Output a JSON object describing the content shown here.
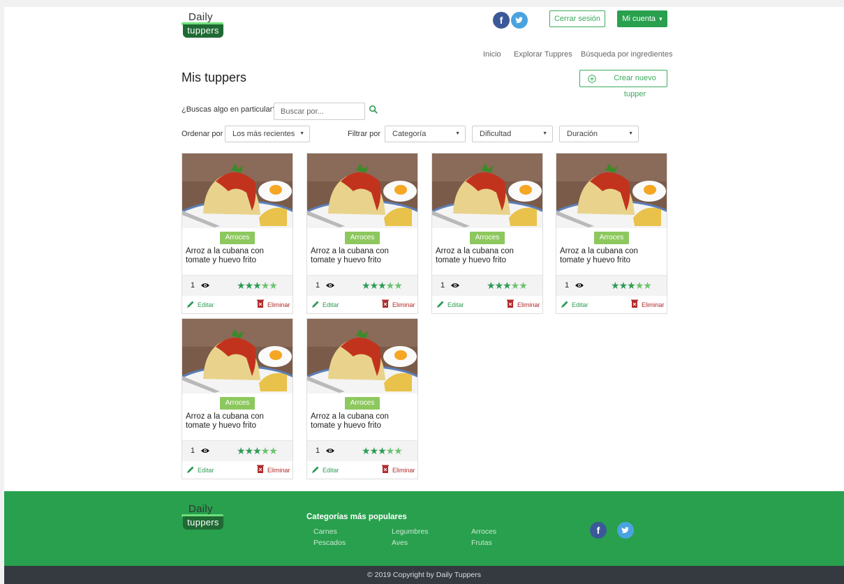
{
  "brand": {
    "line1": "Daily",
    "line2": "tuppers"
  },
  "header": {
    "facebook_glyph": "f",
    "twitter_glyph": "t",
    "logout_label": "Cerrar sesión",
    "account_label": "Mi cuenta",
    "account_caret": "▾"
  },
  "nav": {
    "items": [
      {
        "label": "Inicio"
      },
      {
        "label": "Explorar Tuppres"
      },
      {
        "label": "Búsqueda por ingredientes"
      }
    ]
  },
  "main": {
    "title": "Mis tuppers",
    "create_label": "Crear nuevo tupper",
    "search_label": "¿Buscas algo en particular?",
    "search_placeholder": "Buscar por...",
    "sort_label": "Ordenar por",
    "sort_value": "Los más recientes",
    "filter_label": "Filtrar por",
    "filter_category": "Categoría",
    "filter_difficulty": "Dificultad",
    "filter_duration": "Duración",
    "select_arrow": "▼"
  },
  "cards": [
    {
      "category": "Arroces",
      "title": "Arroz a la cubana con tomate y huevo frito",
      "views": "1",
      "rating": 5,
      "edit": "Editar",
      "delete": "Eliminar"
    },
    {
      "category": "Arroces",
      "title": "Arroz a la cubana con tomate y huevo frito",
      "views": "1",
      "rating": 5,
      "edit": "Editar",
      "delete": "Eliminar"
    },
    {
      "category": "Arroces",
      "title": "Arroz a la cubana con tomate y huevo frito",
      "views": "1",
      "rating": 5,
      "edit": "Editar",
      "delete": "Eliminar"
    },
    {
      "category": "Arroces",
      "title": "Arroz a la cubana con tomate y huevo frito",
      "views": "1",
      "rating": 5,
      "edit": "Editar",
      "delete": "Eliminar"
    },
    {
      "category": "Arroces",
      "title": "Arroz a la cubana con tomate y huevo frito",
      "views": "1",
      "rating": 5,
      "edit": "Editar",
      "delete": "Eliminar"
    },
    {
      "category": "Arroces",
      "title": "Arroz a la cubana con tomate y huevo frito",
      "views": "1",
      "rating": 5,
      "edit": "Editar",
      "delete": "Eliminar"
    }
  ],
  "footer": {
    "heading": "Categorías más populares",
    "categories": [
      "Carnes",
      "Legumbres",
      "Arroces",
      "Pescados",
      "Aves",
      "Frutas"
    ],
    "copyright": "© 2019 Copyright by Daily Tuppers"
  },
  "colors": {
    "primary_green": "#28a04d",
    "badge_green": "#8dc85e",
    "delete_red": "#b02a2a",
    "facebook": "#3b5998",
    "twitter": "#4aa3df",
    "footer_dark": "#343a40"
  },
  "icons": {
    "search": "search-icon",
    "create": "plus-circle-icon",
    "views": "eye-icon",
    "edit": "pencil-icon",
    "delete": "trash-icon",
    "star": "star-icon"
  }
}
